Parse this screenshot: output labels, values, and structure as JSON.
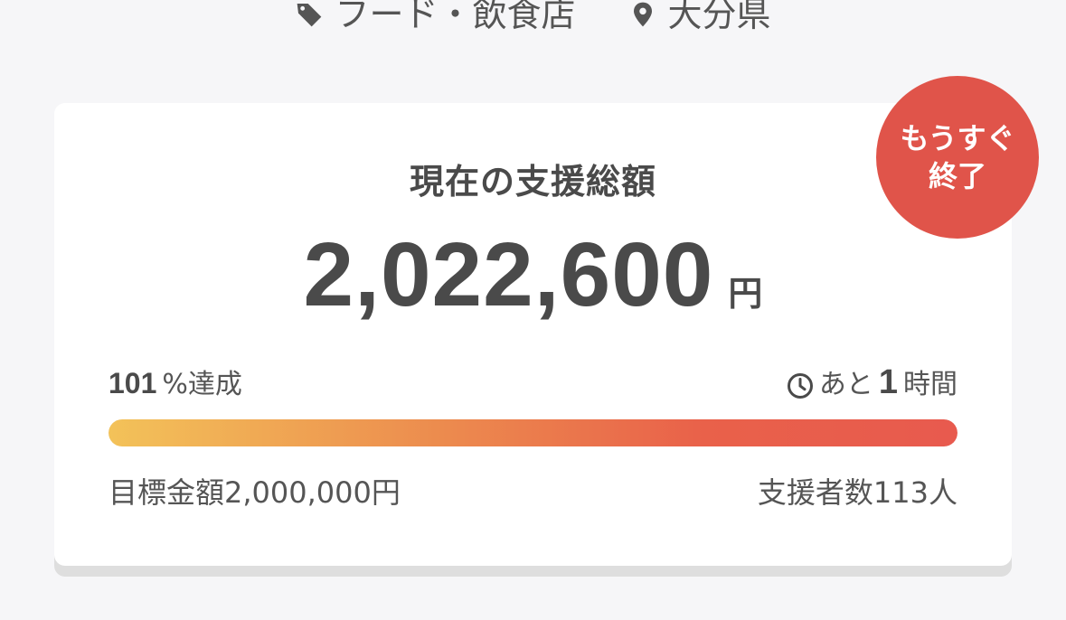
{
  "meta": {
    "category": "フード・飲食店",
    "category_icon": "tag-icon",
    "location": "大分県",
    "location_icon": "map-pin-icon"
  },
  "funding": {
    "title": "現在の支援総額",
    "amount": "2,022,600",
    "unit": "円",
    "achievement_number": "101",
    "achievement_label": "%達成",
    "remaining_prefix": "あと",
    "remaining_number": "1",
    "remaining_suffix": "時間",
    "progress_percent": 101,
    "goal_text": "目標金額2,000,000円",
    "supporters_text": "支援者数113人"
  },
  "badge": {
    "line1": "もうすぐ",
    "line2": "終了"
  },
  "colors": {
    "badge_bg": "#e0544a",
    "progress_start": "#f3c259",
    "progress_end": "#e85a4e",
    "text_main": "#4a4a4a"
  }
}
